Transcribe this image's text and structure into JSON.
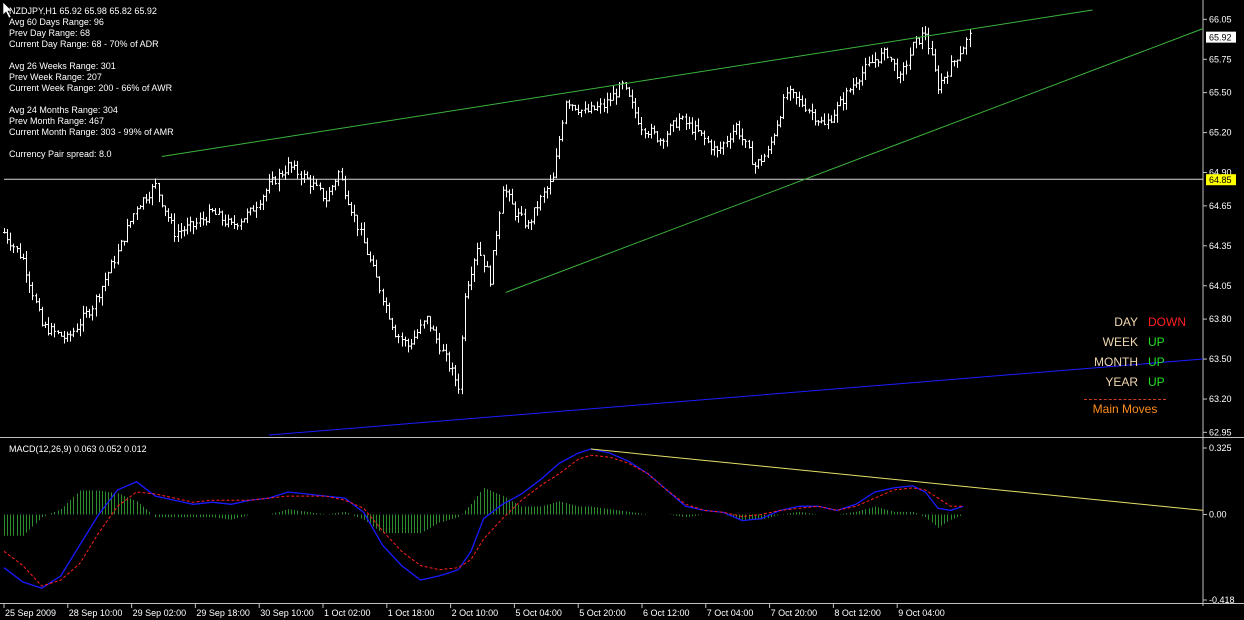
{
  "header": {
    "symbol_line": "NZDJPY,H1  65.92 65.98 65.82 65.92",
    "stats": [
      "Avg 60 Days Range: 96",
      "Prev Day Range: 68",
      "Current Day Range: 68 - 70% of ADR",
      "",
      "Avg 26 Weeks Range: 301",
      "Prev Week Range: 207",
      "Current Week Range: 200 - 66% of AWR",
      "",
      "Avg 24 Months Range: 304",
      "Prev Month Range: 467",
      "Current Month Range: 303 - 99% of AMR",
      "",
      "Currency Pair spread: 8.0"
    ]
  },
  "trend_panel": {
    "rows": [
      {
        "label": "DAY",
        "value": "DOWN",
        "color": "#ff2020"
      },
      {
        "label": "WEEK",
        "value": "UP",
        "color": "#20e020"
      },
      {
        "label": "MONTH",
        "value": "UP",
        "color": "#20e020"
      },
      {
        "label": "YEAR",
        "value": "UP",
        "color": "#20e020"
      }
    ],
    "footer": "Main Moves"
  },
  "colors": {
    "background": "#000000",
    "grid": "#c0c0c0",
    "candles": "#ffffff",
    "trendline_green": "#3cb43c",
    "trendline_blue": "#1c1cff",
    "macd_line": "#1a1aff",
    "signal_line": "#ff2020",
    "histogram": "#2e8b2e",
    "macd_trendline": "#e6e06a",
    "price_tag_yellow": "#ffff00"
  },
  "chart_data": {
    "type": "candlestick",
    "symbol": "NZDJPY",
    "timeframe": "H1",
    "price_axis": {
      "ticks": [
        "66.05",
        "65.75",
        "65.50",
        "65.20",
        "64.90",
        "64.65",
        "64.35",
        "64.05",
        "63.80",
        "63.50",
        "63.20",
        "62.95"
      ],
      "ylim": [
        62.93,
        66.12
      ],
      "current_price": "65.92",
      "horizontal_line_price": "64.85"
    },
    "time_axis": {
      "labels": [
        "25 Sep 2009",
        "28 Sep 10:00",
        "29 Sep 02:00",
        "29 Sep 18:00",
        "30 Sep 10:00",
        "1 Oct 02:00",
        "1 Oct 18:00",
        "2 Oct 10:00",
        "5 Oct 04:00",
        "5 Oct 20:00",
        "6 Oct 12:00",
        "7 Oct 04:00",
        "7 Oct 20:00",
        "8 Oct 12:00",
        "9 Oct 04:00"
      ]
    },
    "close_path": [
      [
        0,
        64.45
      ],
      [
        6,
        64.25
      ],
      [
        12,
        63.75
      ],
      [
        20,
        63.65
      ],
      [
        28,
        63.9
      ],
      [
        36,
        64.3
      ],
      [
        42,
        64.65
      ],
      [
        48,
        64.8
      ],
      [
        54,
        64.45
      ],
      [
        60,
        64.5
      ],
      [
        66,
        64.6
      ],
      [
        72,
        64.5
      ],
      [
        78,
        64.6
      ],
      [
        84,
        64.8
      ],
      [
        90,
        64.95
      ],
      [
        96,
        64.85
      ],
      [
        102,
        64.7
      ],
      [
        106,
        64.9
      ],
      [
        112,
        64.5
      ],
      [
        118,
        64.1
      ],
      [
        124,
        63.7
      ],
      [
        128,
        63.6
      ],
      [
        134,
        63.8
      ],
      [
        140,
        63.5
      ],
      [
        144,
        63.3
      ],
      [
        146,
        64.0
      ],
      [
        150,
        64.35
      ],
      [
        154,
        64.1
      ],
      [
        158,
        64.8
      ],
      [
        162,
        64.6
      ],
      [
        166,
        64.5
      ],
      [
        170,
        64.7
      ],
      [
        174,
        64.85
      ],
      [
        178,
        65.45
      ],
      [
        184,
        65.35
      ],
      [
        190,
        65.4
      ],
      [
        196,
        65.55
      ],
      [
        202,
        65.25
      ],
      [
        208,
        65.15
      ],
      [
        214,
        65.3
      ],
      [
        220,
        65.2
      ],
      [
        226,
        65.05
      ],
      [
        232,
        65.25
      ],
      [
        238,
        64.95
      ],
      [
        242,
        65.05
      ],
      [
        248,
        65.5
      ],
      [
        254,
        65.4
      ],
      [
        260,
        65.25
      ],
      [
        266,
        65.45
      ],
      [
        270,
        65.6
      ],
      [
        276,
        65.75
      ],
      [
        280,
        65.8
      ],
      [
        284,
        65.6
      ],
      [
        288,
        65.85
      ],
      [
        292,
        65.95
      ],
      [
        296,
        65.55
      ],
      [
        300,
        65.7
      ],
      [
        304,
        65.85
      ],
      [
        306,
        65.92
      ]
    ],
    "trendlines": [
      {
        "name": "upper channel",
        "color": "green",
        "from": [
          50,
          65.02
        ],
        "to": [
          345,
          66.12
        ]
      },
      {
        "name": "lower channel",
        "color": "green",
        "from": [
          159,
          64.0
        ],
        "to": [
          380,
          65.98
        ]
      },
      {
        "name": "long-term support",
        "color": "blue",
        "from": [
          84,
          62.93
        ],
        "to": [
          380,
          63.5
        ]
      }
    ],
    "macd": {
      "label": "MACD(12,26,9) 0.063 0.052 0.012",
      "params": [
        12,
        26,
        9
      ],
      "values": {
        "main": 0.063,
        "signal": 0.052,
        "histogram": 0.012
      },
      "y_ticks": [
        "0.325",
        "0.00",
        "-0.418"
      ],
      "ylim": [
        -0.418,
        0.325
      ],
      "main_path": [
        [
          0,
          -0.26
        ],
        [
          6,
          -0.33
        ],
        [
          12,
          -0.36
        ],
        [
          18,
          -0.3
        ],
        [
          24,
          -0.15
        ],
        [
          30,
          0.0
        ],
        [
          36,
          0.12
        ],
        [
          42,
          0.16
        ],
        [
          48,
          0.09
        ],
        [
          54,
          0.07
        ],
        [
          60,
          0.05
        ],
        [
          66,
          0.06
        ],
        [
          72,
          0.05
        ],
        [
          78,
          0.07
        ],
        [
          84,
          0.08
        ],
        [
          90,
          0.11
        ],
        [
          96,
          0.1
        ],
        [
          102,
          0.09
        ],
        [
          108,
          0.08
        ],
        [
          114,
          0.01
        ],
        [
          120,
          -0.15
        ],
        [
          126,
          -0.25
        ],
        [
          132,
          -0.32
        ],
        [
          138,
          -0.3
        ],
        [
          144,
          -0.27
        ],
        [
          148,
          -0.18
        ],
        [
          152,
          -0.02
        ],
        [
          158,
          0.05
        ],
        [
          164,
          0.1
        ],
        [
          170,
          0.17
        ],
        [
          176,
          0.25
        ],
        [
          182,
          0.3
        ],
        [
          186,
          0.32
        ],
        [
          192,
          0.3
        ],
        [
          198,
          0.26
        ],
        [
          204,
          0.2
        ],
        [
          210,
          0.12
        ],
        [
          216,
          0.04
        ],
        [
          222,
          0.02
        ],
        [
          228,
          0.01
        ],
        [
          234,
          -0.03
        ],
        [
          240,
          -0.02
        ],
        [
          246,
          0.02
        ],
        [
          252,
          0.04
        ],
        [
          258,
          0.04
        ],
        [
          264,
          0.02
        ],
        [
          270,
          0.05
        ],
        [
          276,
          0.11
        ],
        [
          282,
          0.13
        ],
        [
          288,
          0.14
        ],
        [
          292,
          0.11
        ],
        [
          296,
          0.03
        ],
        [
          300,
          0.02
        ],
        [
          304,
          0.04
        ]
      ],
      "signal_path": [
        [
          0,
          -0.18
        ],
        [
          6,
          -0.25
        ],
        [
          12,
          -0.35
        ],
        [
          18,
          -0.32
        ],
        [
          24,
          -0.24
        ],
        [
          30,
          -0.09
        ],
        [
          36,
          0.04
        ],
        [
          42,
          0.11
        ],
        [
          48,
          0.1
        ],
        [
          54,
          0.08
        ],
        [
          60,
          0.06
        ],
        [
          66,
          0.07
        ],
        [
          72,
          0.07
        ],
        [
          78,
          0.07
        ],
        [
          84,
          0.08
        ],
        [
          90,
          0.09
        ],
        [
          96,
          0.09
        ],
        [
          102,
          0.09
        ],
        [
          108,
          0.07
        ],
        [
          114,
          0.03
        ],
        [
          120,
          -0.08
        ],
        [
          126,
          -0.18
        ],
        [
          132,
          -0.25
        ],
        [
          138,
          -0.27
        ],
        [
          144,
          -0.26
        ],
        [
          148,
          -0.22
        ],
        [
          152,
          -0.12
        ],
        [
          158,
          -0.02
        ],
        [
          164,
          0.07
        ],
        [
          170,
          0.14
        ],
        [
          176,
          0.2
        ],
        [
          182,
          0.27
        ],
        [
          186,
          0.29
        ],
        [
          192,
          0.28
        ],
        [
          198,
          0.25
        ],
        [
          204,
          0.2
        ],
        [
          210,
          0.12
        ],
        [
          216,
          0.05
        ],
        [
          222,
          0.02
        ],
        [
          228,
          0.01
        ],
        [
          234,
          -0.01
        ],
        [
          240,
          0.0
        ],
        [
          246,
          0.02
        ],
        [
          252,
          0.03
        ],
        [
          258,
          0.04
        ],
        [
          264,
          0.02
        ],
        [
          270,
          0.04
        ],
        [
          276,
          0.08
        ],
        [
          282,
          0.12
        ],
        [
          288,
          0.13
        ],
        [
          292,
          0.12
        ],
        [
          296,
          0.08
        ],
        [
          300,
          0.04
        ],
        [
          304,
          0.04
        ]
      ],
      "trendline": {
        "color": "yellow",
        "from": [
          186,
          0.32
        ],
        "to": [
          380,
          0.02
        ]
      }
    }
  }
}
